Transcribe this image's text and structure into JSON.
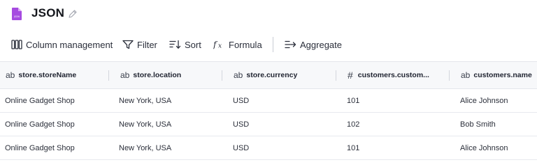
{
  "title": "JSON",
  "toolbar": {
    "column_management": "Column management",
    "filter": "Filter",
    "sort": "Sort",
    "formula": "Formula",
    "aggregate": "Aggregate"
  },
  "columns": [
    {
      "type": "ab",
      "label": "store.storeName"
    },
    {
      "type": "ab",
      "label": "store.location"
    },
    {
      "type": "ab",
      "label": "store.currency"
    },
    {
      "type": "#",
      "label": "customers.custom..."
    },
    {
      "type": "ab",
      "label": "customers.name"
    }
  ],
  "rows": [
    [
      "Online Gadget Shop",
      "New York, USA",
      "USD",
      "101",
      "Alice Johnson"
    ],
    [
      "Online Gadget Shop",
      "New York, USA",
      "USD",
      "102",
      "Bob Smith"
    ],
    [
      "Online Gadget Shop",
      "New York, USA",
      "USD",
      "101",
      "Alice Johnson"
    ]
  ],
  "colors": {
    "file_icon": "#a64be0",
    "header_bg": "#f7f8fa",
    "row_border": "#e7e9ee"
  },
  "icons": [
    "file-json-icon",
    "pencil-icon",
    "columns-icon",
    "filter-icon",
    "sort-icon",
    "formula-icon",
    "aggregate-icon"
  ]
}
